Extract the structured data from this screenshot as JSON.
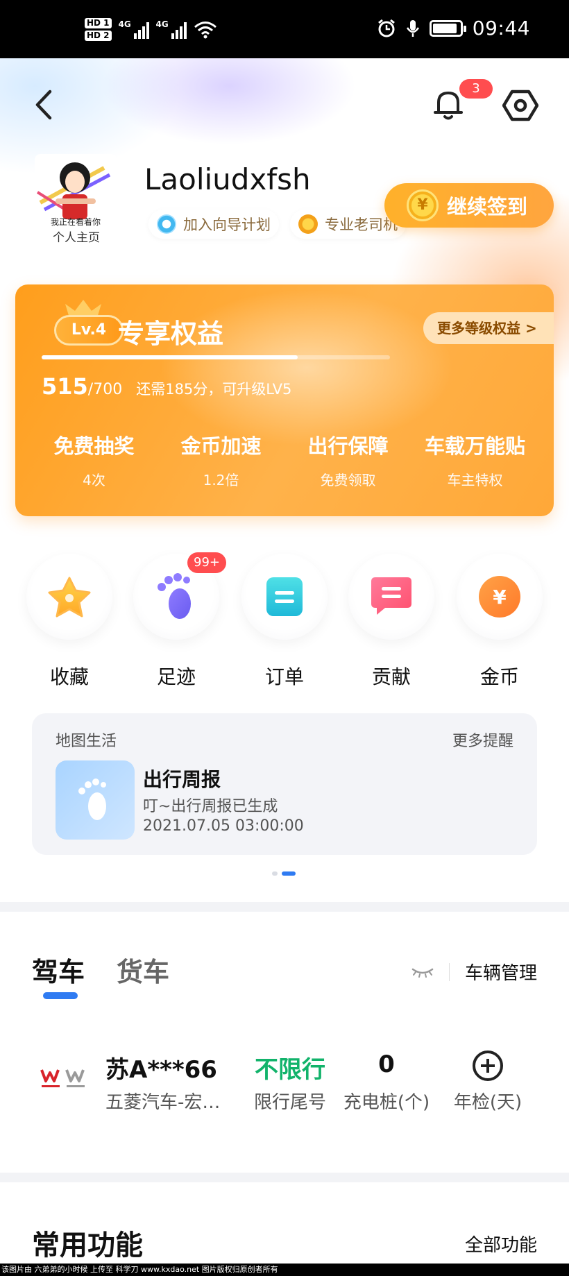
{
  "status_bar": {
    "hd1": "HD 1",
    "hd2": "HD 2",
    "signal1": "4G",
    "signal2": "4G",
    "time": "09:44",
    "icons": [
      "wifi-icon",
      "alarm-icon",
      "mic-icon",
      "battery-icon"
    ],
    "battery_level": 0.9
  },
  "header": {
    "notification_count": "3",
    "icons": [
      "back-arrow-icon",
      "bell-icon",
      "settings-icon"
    ]
  },
  "profile": {
    "avatar_caption": "个人主页",
    "username": "Laoliudxfsh",
    "chips": [
      {
        "label": "加入向导计划",
        "icon": "guide-icon"
      },
      {
        "label": "专业老司机",
        "icon": "medal-icon"
      }
    ],
    "checkin_label": "继续签到",
    "checkin_coin": "¥"
  },
  "level_card": {
    "level": "Lv.4",
    "title": "专享权益",
    "more_link": "更多等级权益 >",
    "score": "515",
    "score_max": "/700",
    "progress": 0.736,
    "hint": "还需185分，可升级LV5",
    "perks": [
      {
        "title": "免费抽奖",
        "sub": "4次"
      },
      {
        "title": "金币加速",
        "sub": "1.2倍"
      },
      {
        "title": "出行保障",
        "sub": "免费领取"
      },
      {
        "title": "车载万能贴",
        "sub": "车主特权"
      }
    ]
  },
  "quick_actions": [
    {
      "label": "收藏",
      "icon": "star-icon"
    },
    {
      "label": "足迹",
      "icon": "footprint-icon",
      "badge": "99+"
    },
    {
      "label": "订单",
      "icon": "order-icon"
    },
    {
      "label": "贡献",
      "icon": "contribution-icon"
    },
    {
      "label": "金币",
      "icon": "coin-icon",
      "glyph": "¥"
    }
  ],
  "map_life": {
    "title": "地图生活",
    "more": "更多提醒",
    "item_title": "出行周报",
    "item_sub": "叮~出行周报已生成",
    "item_date": "2021.07.05 03:00:00",
    "page": 2,
    "pages": 2
  },
  "vehicle": {
    "tabs": [
      {
        "label": "驾车",
        "active": true
      },
      {
        "label": "货车",
        "active": false
      }
    ],
    "manage_label": "车辆管理",
    "brand_logo": "wuling-logo",
    "plate": "苏A***66",
    "car_name": "五菱汽车-宏…",
    "stats": [
      {
        "value": "不限行",
        "label": "限行尾号",
        "color": "#12b36b"
      },
      {
        "value": "0",
        "label": "充电桩(个)"
      },
      {
        "value": "",
        "label": "年检(天)",
        "icon": "add-icon"
      }
    ]
  },
  "common_functions": {
    "title": "常用功能",
    "all_label": "全部功能"
  },
  "footer_text": "该图片由 六弟弟的小时候 上传至 科学刀 www.kxdao.net 图片版权归原创者所有",
  "colors": {
    "accent_blue": "#2f7bf2",
    "orange": "#ffa53f",
    "badge_red": "#ff4d4f",
    "green": "#12b36b"
  }
}
